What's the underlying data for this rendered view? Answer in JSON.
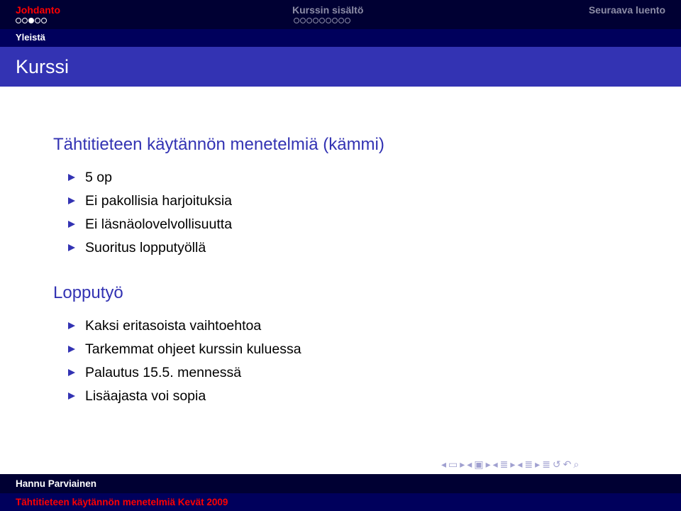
{
  "header": {
    "sections": [
      "Johdanto",
      "Kurssin sisältö",
      "Seuraava luento"
    ],
    "subsection": "Yleistä",
    "intro_dots": [
      false,
      false,
      true,
      false,
      false
    ],
    "content_dots_count": 9
  },
  "frame_title": "Kurssi",
  "block1": {
    "title": "Tähtitieteen käytännön menetelmiä (kämmi)",
    "items": [
      "5 op",
      "Ei pakollisia harjoituksia",
      "Ei läsnäolovelvollisuutta",
      "Suoritus lopputyöllä"
    ]
  },
  "block2": {
    "title": "Lopputyö",
    "items": [
      "Kaksi eritasoista vaihtoehtoa",
      "Tarkemmat ohjeet kurssin kuluessa",
      "Palautus 15.5. mennessä",
      "Lisäajasta voi sopia"
    ]
  },
  "nav_symbols": [
    "◂",
    "▭",
    "▸",
    "◂",
    "▣",
    "▸",
    "◂",
    "≣",
    "▸",
    "◂",
    "≣",
    "▸",
    "≣",
    "↺",
    "↶",
    "⌕"
  ],
  "footer": {
    "author": "Hannu Parviainen",
    "course": "Tähtitieteen käytännön menetelmiä Kevät 2009"
  },
  "colors": {
    "dark_bar": "#000033",
    "sub_bar": "#00005c",
    "title_bar": "#3333b3",
    "accent_red": "#ff0000"
  }
}
